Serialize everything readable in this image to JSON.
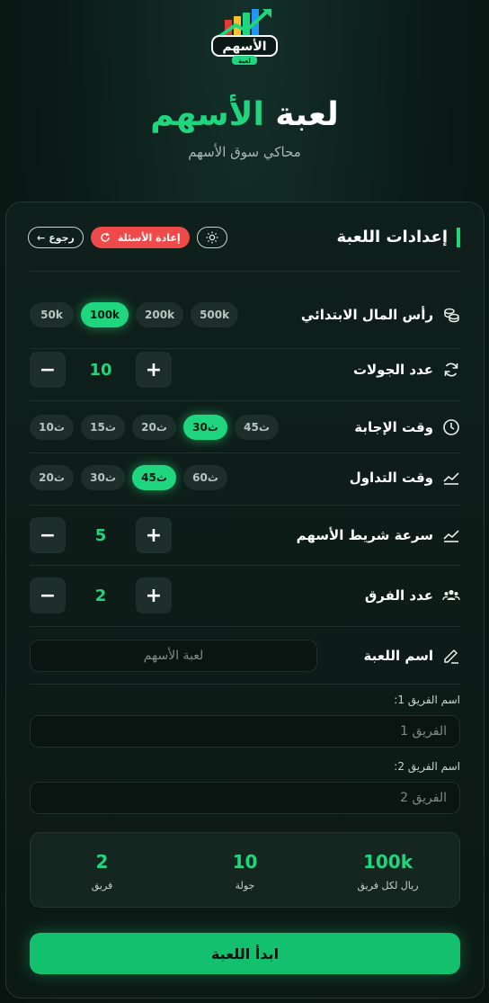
{
  "header": {
    "logo_text": "الأسهم",
    "logo_sub": "لعبة",
    "title_part1": "لعبة",
    "title_part2": "الأسهم",
    "subtitle": "محاكي سوق الأسهم"
  },
  "settings": {
    "title": "إعدادات اللعبة",
    "back_label": "رجوع",
    "reset_label": "إعادة الأسئلة",
    "capital": {
      "label": "رأس المال الابتدائي",
      "options": [
        "50k",
        "100k",
        "200k",
        "500k"
      ],
      "selected": "100k"
    },
    "rounds": {
      "label": "عدد الجولات",
      "value": "10",
      "minus": "−",
      "plus": "+"
    },
    "answer_time": {
      "label": "وقت الإجابة",
      "options": [
        "10ث",
        "15ث",
        "20ث",
        "30ث",
        "45ث"
      ],
      "selected": "30ث"
    },
    "trade_time": {
      "label": "وقت التداول",
      "options": [
        "20ث",
        "30ث",
        "45ث",
        "60ث"
      ],
      "selected": "45ث"
    },
    "ticker_speed": {
      "label": "سرعة شريط الأسهم",
      "value": "5",
      "minus": "−",
      "plus": "+"
    },
    "teams": {
      "label": "عدد الفرق",
      "value": "2",
      "minus": "−",
      "plus": "+"
    },
    "game_name": {
      "label": "اسم اللعبة",
      "value": "لعبة الأسهم"
    },
    "team1": {
      "label": "اسم الفريق 1:",
      "placeholder": "الفريق 1"
    },
    "team2": {
      "label": "اسم الفريق 2:",
      "placeholder": "الفريق 2"
    }
  },
  "summary": {
    "capital_value": "100k",
    "capital_label": "ريال لكل فريق",
    "rounds_value": "10",
    "rounds_label": "جولة",
    "teams_value": "2",
    "teams_label": "فريق"
  },
  "start_label": "ابدأ اللعبة",
  "colors": {
    "accent": "#1fd67e",
    "danger": "#ef4a4a",
    "background": "#0b1a16"
  }
}
